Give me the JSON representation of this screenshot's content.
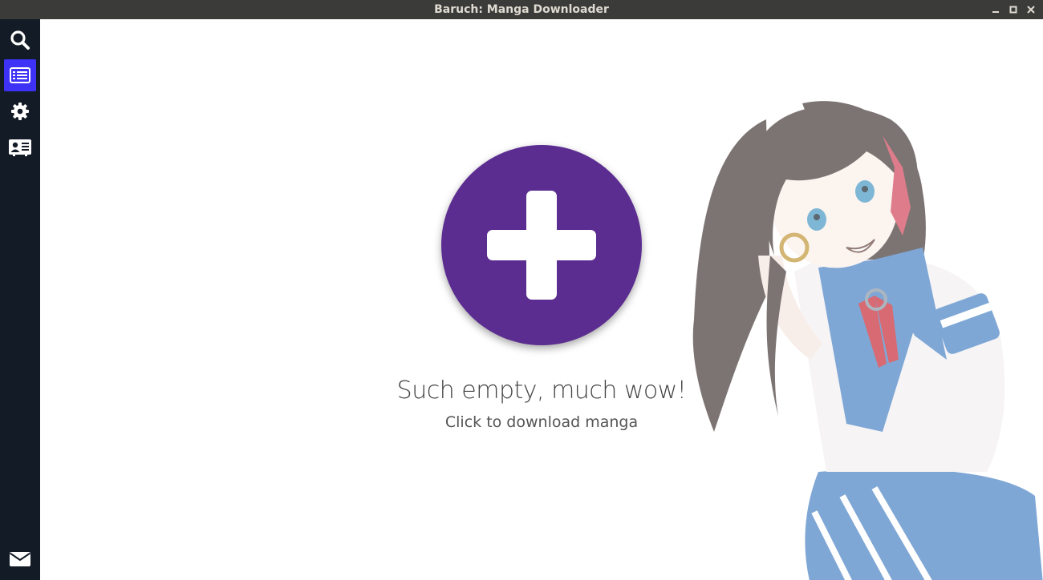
{
  "window": {
    "title": "Baruch: Manga Downloader"
  },
  "sidebar": {
    "items": [
      {
        "name": "search",
        "icon": "search-icon"
      },
      {
        "name": "list",
        "icon": "list-icon",
        "active": true
      },
      {
        "name": "settings",
        "icon": "gear-icon"
      },
      {
        "name": "about",
        "icon": "contact-card-icon"
      },
      {
        "name": "mail",
        "icon": "envelope-icon"
      }
    ],
    "active_color": "#3d32f5",
    "background": "#131b26"
  },
  "main": {
    "add_button_color": "#5c2d91",
    "empty_title": "Such empty, much wow!",
    "empty_subtitle": "Click to download manga"
  }
}
